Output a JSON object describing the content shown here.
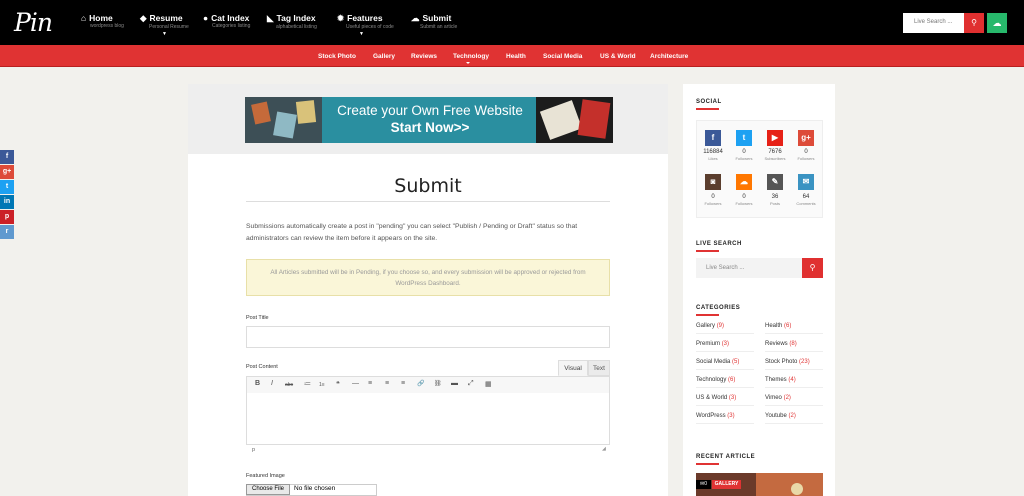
{
  "site": {
    "logo": "Pin"
  },
  "nav": [
    {
      "icon": "⌂",
      "label": "Home",
      "sub": "wordpress blog"
    },
    {
      "icon": "◆",
      "label": "Resume",
      "sub": "Personal Resume"
    },
    {
      "icon": "●",
      "label": "Cat Index",
      "sub": "Categories listing"
    },
    {
      "icon": "◣",
      "label": "Tag Index",
      "sub": "alphabetical listing"
    },
    {
      "icon": "✹",
      "label": "Features",
      "sub": "Useful pieces of code"
    },
    {
      "icon": "☁",
      "label": "Submit",
      "sub": "Submit an article"
    }
  ],
  "search": {
    "placeholder": "Live Search ...",
    "button_icon": "search-icon",
    "upload_icon": "cloud-upload-icon"
  },
  "categories_bar": [
    "Stock Photo",
    "Gallery",
    "Reviews",
    "Technology",
    "Health",
    "Social Media",
    "US & World",
    "Architecture"
  ],
  "float_share": [
    {
      "icon": "f",
      "color": "#3b5998"
    },
    {
      "icon": "g+",
      "color": "#dd4b39"
    },
    {
      "icon": "t",
      "color": "#1da1f2"
    },
    {
      "icon": "in",
      "color": "#0077b5"
    },
    {
      "icon": "p",
      "color": "#cb2027"
    },
    {
      "icon": "r",
      "color": "#5f99cf"
    }
  ],
  "ad": {
    "line1": "Create your Own Free Website",
    "line2": "Start Now>>"
  },
  "page": {
    "title": "Submit",
    "intro": "Submissions automatically create a post in \"pending\" you can select \"Publish / Pending or Draft\" status so that administrators can review the item before it appears on the site.",
    "notice": "All Articles submitted will be in Pending, if you choose so, and every submission will be approved or rejected from WordPress Dashboard.",
    "post_title_label": "Post Title",
    "post_content_label": "Post Content",
    "tab_visual": "Visual",
    "tab_text": "Text",
    "toolbar": [
      "B",
      "I",
      "abc",
      "≔",
      "1≡",
      "❝",
      "—",
      "≡",
      "≡",
      "≡",
      "🔗",
      "⛓",
      "▬",
      "⤢",
      "▦"
    ],
    "status_path": "p",
    "featured_label": "Featured Image",
    "choose_file": "Choose File",
    "no_file": "No file chosen"
  },
  "sidebar": {
    "social_title": "SOCIAL",
    "social": [
      {
        "icon": "f",
        "color": "#3b5998",
        "count": "116884",
        "label": "Likes"
      },
      {
        "icon": "t",
        "color": "#1da1f2",
        "count": "0",
        "label": "Followers"
      },
      {
        "icon": "▶",
        "color": "#e62117",
        "count": "7676",
        "label": "Subscribers"
      },
      {
        "icon": "g+",
        "color": "#dd4b39",
        "count": "0",
        "label": "Followers"
      },
      {
        "icon": "◙",
        "color": "#5b3e2e",
        "count": "0",
        "label": "Followers"
      },
      {
        "icon": "☁",
        "color": "#ff7700",
        "count": "0",
        "label": "Followers"
      },
      {
        "icon": "✎",
        "color": "#555555",
        "count": "36",
        "label": "Posts"
      },
      {
        "icon": "✉",
        "color": "#3a93c2",
        "count": "64",
        "label": "Comments"
      }
    ],
    "live_search_title": "LIVE SEARCH",
    "live_search_placeholder": "Live Search ...",
    "categories_title": "CATEGORIES",
    "categories": [
      {
        "name": "Gallery",
        "count": "(9)"
      },
      {
        "name": "Health",
        "count": "(6)"
      },
      {
        "name": "Premium",
        "count": "(3)"
      },
      {
        "name": "Reviews",
        "count": "(8)"
      },
      {
        "name": "Social Media",
        "count": "(5)"
      },
      {
        "name": "Stock Photo",
        "count": "(23)"
      },
      {
        "name": "Technology",
        "count": "(6)"
      },
      {
        "name": "Themes",
        "count": "(4)"
      },
      {
        "name": "US & World",
        "count": "(3)"
      },
      {
        "name": "Vimeo",
        "count": "(2)"
      },
      {
        "name": "WordPress",
        "count": "(3)"
      },
      {
        "name": "Youtube",
        "count": "(2)"
      }
    ],
    "recent_title": "RECENT ARTICLE",
    "recent_comments": "0",
    "recent_tag": "GALLERY"
  }
}
